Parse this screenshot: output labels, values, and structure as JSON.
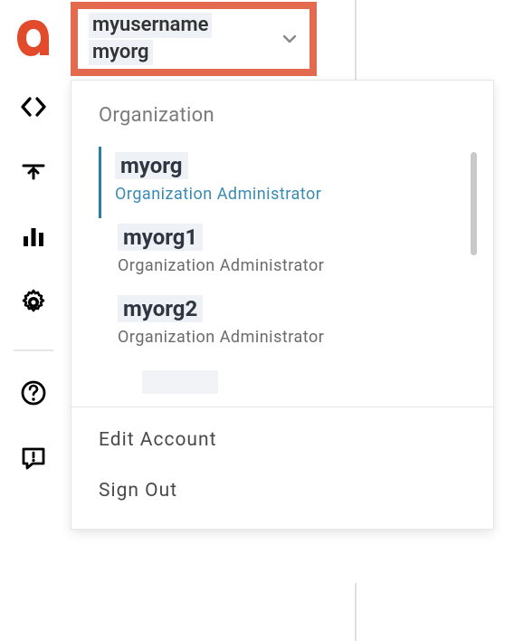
{
  "account": {
    "username": "myusername",
    "current_org": "myorg"
  },
  "dropdown": {
    "section_label": "Organization",
    "orgs": [
      {
        "name": "myorg",
        "role": "Organization Administrator",
        "selected": true
      },
      {
        "name": "myorg1",
        "role": "Organization Administrator",
        "selected": false
      },
      {
        "name": "myorg2",
        "role": "Organization Administrator",
        "selected": false
      }
    ],
    "actions": {
      "edit": "Edit Account",
      "signout": "Sign Out"
    }
  },
  "icons": {
    "logo": "logo-a",
    "code": "code-icon",
    "publish": "publish-icon",
    "analytics": "bar-chart-icon",
    "settings": "gear-icon",
    "help": "help-icon",
    "feedback": "feedback-icon",
    "chevron": "chevron-down-icon"
  }
}
